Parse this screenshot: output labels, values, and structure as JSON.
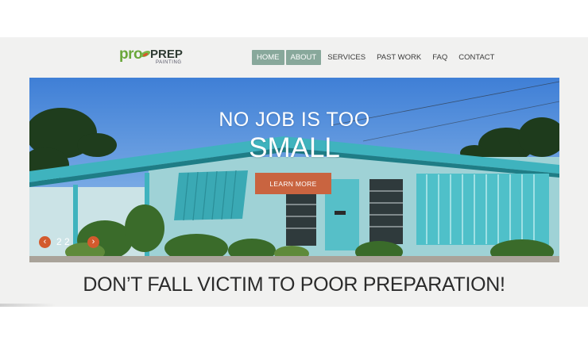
{
  "logo": {
    "pro": "pro",
    "prep": "PREP",
    "sub": "PAINTING"
  },
  "nav": {
    "items": [
      {
        "label": "HOME",
        "active": true
      },
      {
        "label": "ABOUT",
        "active": true
      },
      {
        "label": "SERVICES",
        "active": false
      },
      {
        "label": "PAST WORK",
        "active": false
      },
      {
        "label": "FAQ",
        "active": false
      },
      {
        "label": "CONTACT",
        "active": false
      }
    ]
  },
  "hero": {
    "line1": "NO JOB IS TOO",
    "line2": "SMALL",
    "button": "LEARN MORE",
    "slide_counter": "2 2",
    "prev_icon": "chevron-left-icon",
    "next_icon": "chevron-right-icon"
  },
  "tagline": "DON’T FALL VICTIM TO POOR PREPARATION!",
  "colors": {
    "accent": "#88a89b",
    "button": "#c96440",
    "slider": "#d35a2d",
    "logo_green": "#6aa73a"
  }
}
